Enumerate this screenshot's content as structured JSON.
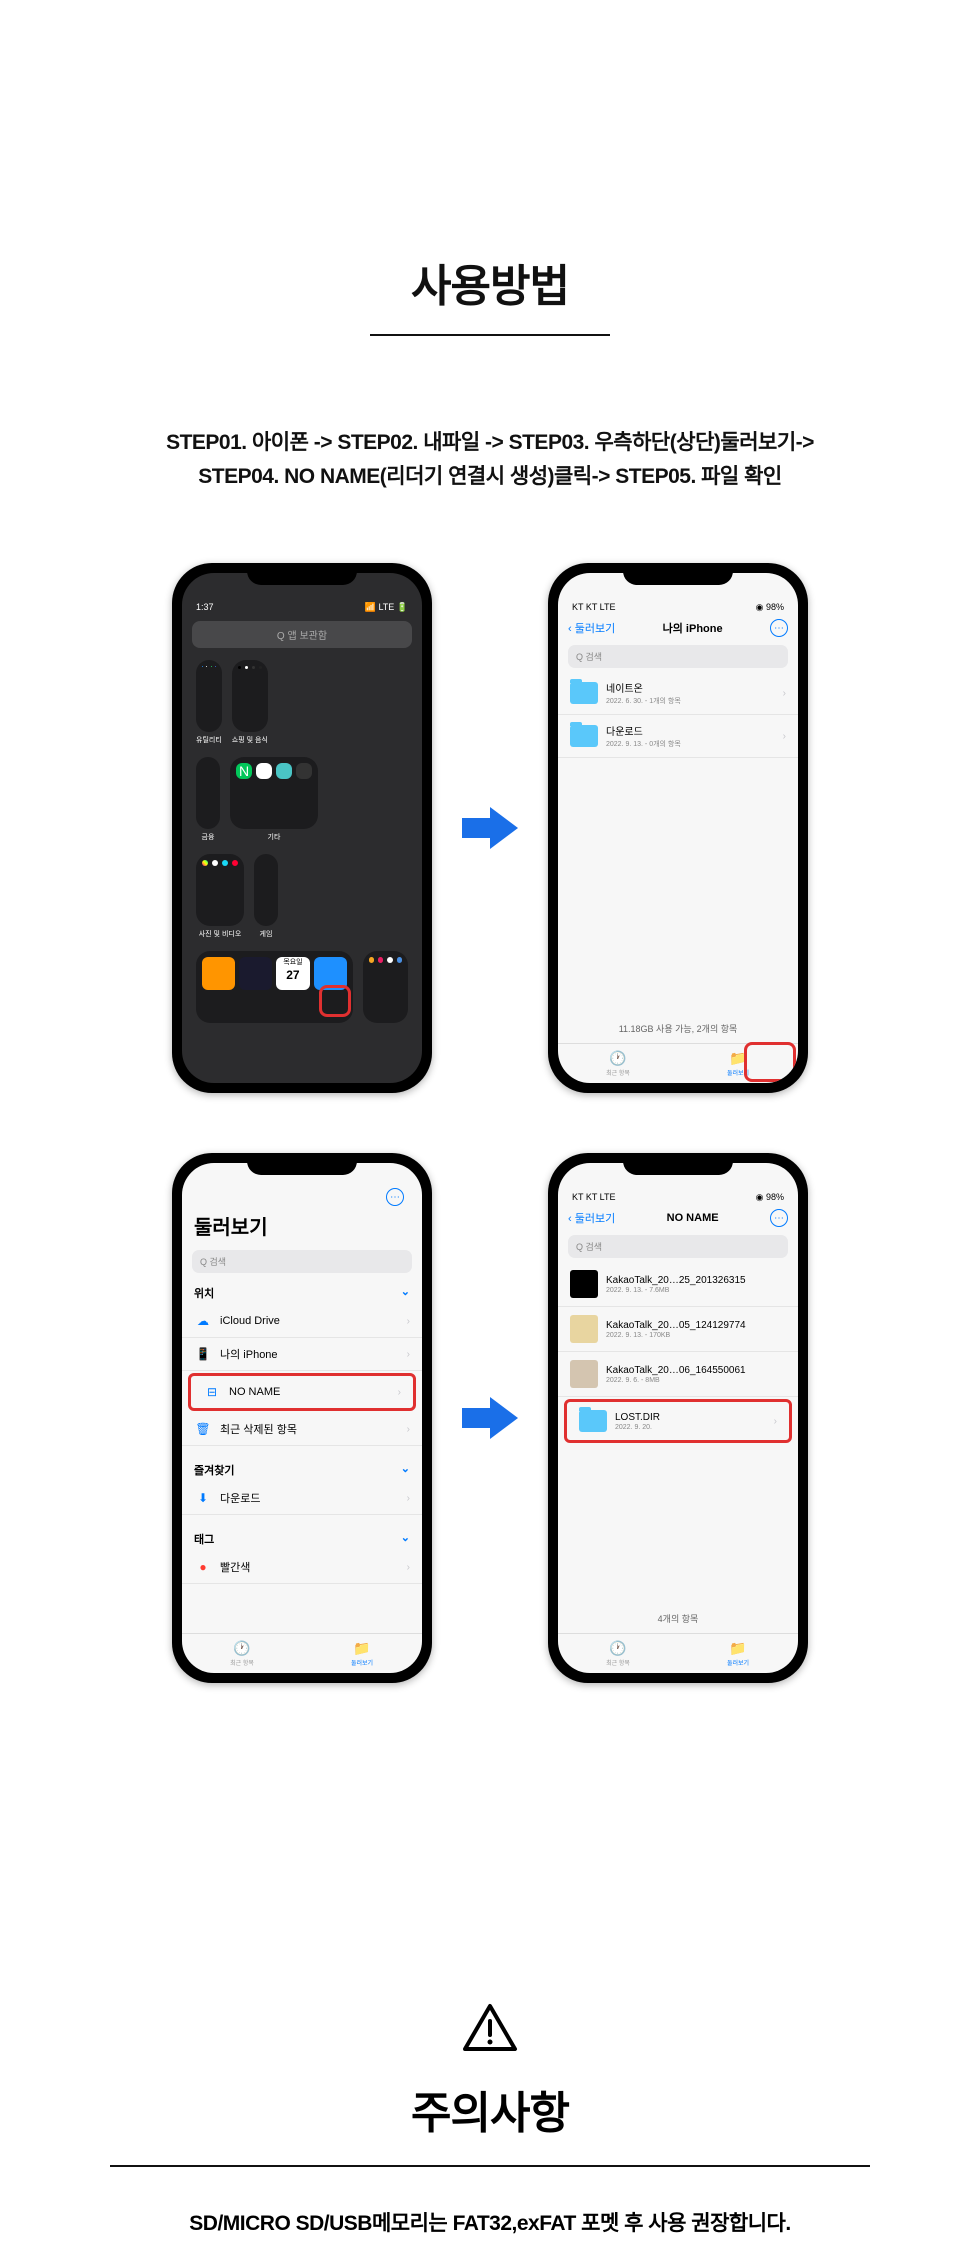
{
  "heading": "사용방법",
  "steps_line1": "STEP01. 아이폰 -> STEP02. 내파일 -> STEP03. 우측하단(상단)둘러보기->",
  "steps_line2": "STEP04. NO NAME(리더기 연결시 생성)클릭-> STEP05. 파일 확인",
  "phone1": {
    "time": "1:37",
    "search": "Q 앱 보관함",
    "widget1_label": "유틸리티",
    "widget2_label": "쇼핑 및 음식",
    "row2_label1": "금융",
    "row2_label2": "기타",
    "row3_label1": "사진 및 비디오",
    "row3_label2": "게임",
    "calendar_day": "목요일",
    "calendar_date": "27"
  },
  "phone2": {
    "status": "KT  KT  LTE",
    "battery": "98%",
    "back": "둘러보기",
    "title": "나의 iPhone",
    "search": "Q 검색",
    "folder1_name": "네이트온",
    "folder1_meta": "2022. 6. 30. - 1개의 항목",
    "folder2_name": "다운로드",
    "folder2_meta": "2022. 9. 13. - 0개의 항목",
    "storage": "11.18GB 사용 가능, 2개의 항목",
    "tab1": "최근 항목",
    "tab2": "둘러보기"
  },
  "phone3": {
    "title": "둘러보기",
    "search": "Q 검색",
    "section1": "위치",
    "item1": "iCloud Drive",
    "item2": "나의 iPhone",
    "item3": "NO NAME",
    "item4": "최근 삭제된 항목",
    "section2": "즐겨찾기",
    "item5": "다운로드",
    "section3": "태그",
    "item6": "빨간색",
    "tab1": "최근 항목",
    "tab2": "둘러보기"
  },
  "phone4": {
    "status": "KT  KT  LTE",
    "battery": "98%",
    "back": "둘러보기",
    "title": "NO NAME",
    "search": "Q 검색",
    "file1_name": "KakaoTalk_20…25_201326315",
    "file1_meta": "2022. 9. 13. - 7.6MB",
    "file2_name": "KakaoTalk_20…05_124129774",
    "file2_meta": "2022. 9. 13. - 170KB",
    "file3_name": "KakaoTalk_20…06_164550061",
    "file3_meta": "2022. 9. 6. - 8MB",
    "file4_name": "LOST.DIR",
    "file4_meta": "2022. 9. 20.",
    "count": "4개의 항목",
    "tab1": "최근 항목",
    "tab2": "둘러보기"
  },
  "warning": {
    "title": "주의사항",
    "text": "SD/MICRO SD/USB메모리는 FAT32,exFAT 포멧 후 사용 권장합니다."
  }
}
